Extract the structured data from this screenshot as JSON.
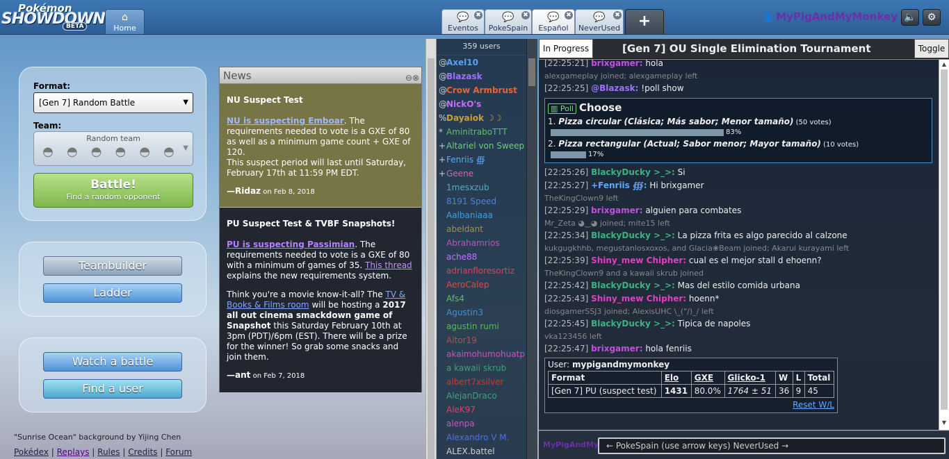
{
  "header": {
    "logo": {
      "line1": "Pokémon",
      "line2": "SHOWDOWN!",
      "line3": "BETA"
    },
    "home_tab": {
      "label": "Home",
      "icon": "home-icon"
    },
    "room_tabs": [
      {
        "label": "Eventos"
      },
      {
        "label": "PokeSpain"
      },
      {
        "label": "Español"
      },
      {
        "label": "NeverUsed"
      }
    ],
    "plus_label": "+",
    "close_glyph": "✖",
    "username": "MyPigAndMyMonkey",
    "sound_icon": "speaker-icon",
    "settings_icon": "gear-icon"
  },
  "mainmenu": {
    "format_label": "Format:",
    "format_value": "[Gen 7] Random Battle",
    "team_label": "Team:",
    "team_value": "Random team",
    "battle_title": "Battle!",
    "battle_sub": "Find a random opponent",
    "teambuilder": "Teambuilder",
    "ladder": "Ladder",
    "watch": "Watch a battle",
    "find_user": "Find a user"
  },
  "footer": {
    "credit": "\"Sunrise Ocean\" background by Yijing Chen",
    "links": [
      "Pokédex",
      "Replays",
      "Rules",
      "Credits",
      "Forum"
    ],
    "sep": " | "
  },
  "news": {
    "title": "News",
    "items": [
      {
        "heading": "NU Suspect Test",
        "link": "NU is suspecting Emboar",
        "body1": ". The requirements needed to vote is a GXE of 80 as well as a minimum game count + GXE of 120.",
        "body2": "This suspect period will last until Saturday, February 17th at 11:59 PM EDT.",
        "author": "—Ridaz",
        "date": " on Feb 8, 2018"
      },
      {
        "heading": "PU Suspect Test & TVBF Snapshots!",
        "link": "PU is suspecting Passimian",
        "body1": ". The requirements needed to vote is a GXE of 80 with a minimum of games of 35.",
        "link2": "This thread",
        "body2": "explains the new requirements system.",
        "body3a": "Think you're a movie know-it-all? The",
        "link3": "TV & Books & Films room",
        "body3b": "will be hosting a",
        "bold3": "2017 all out cinema smackdown game of Snapshot",
        "body3c": "this Saturday February 10th at 3pm (PDT)/6pm (EST). There will be a prize for the winner! So grab some snacks and join them.",
        "author": "—ant",
        "date": " on Feb 7, 2018"
      }
    ]
  },
  "userlist": {
    "count": "359 users",
    "users": [
      {
        "g": "@",
        "n": "Axel10",
        "c": "#5da0f0",
        "b": true
      },
      {
        "g": "@",
        "n": "Blazask",
        "c": "#a070ff",
        "b": true
      },
      {
        "g": "@",
        "n": "Crow Armbrust",
        "c": "#f06030",
        "b": true
      },
      {
        "g": "@",
        "n": "NickO's",
        "c": "#c070f0",
        "b": true
      },
      {
        "g": "%",
        "n": "Dayaiok ☽☽",
        "c": "#c8a030",
        "b": true
      },
      {
        "g": "*",
        "n": "AminitraboTTT",
        "c": "#60c060",
        "b": false
      },
      {
        "g": "+",
        "n": "Altariel von Sweep",
        "c": "#70d070",
        "b": false
      },
      {
        "g": "+",
        "n": "Fenriis ∰",
        "c": "#60a8ff",
        "b": false
      },
      {
        "g": "+",
        "n": "Geene",
        "c": "#e060a0",
        "b": false
      },
      {
        "g": "",
        "n": "1mesxzub",
        "c": "#50b0c0",
        "b": false
      },
      {
        "g": "",
        "n": "8191 Speed",
        "c": "#5080e0",
        "b": false
      },
      {
        "g": "",
        "n": "Aalbaniaaa",
        "c": "#40a0e0",
        "b": false
      },
      {
        "g": "",
        "n": "abeldant",
        "c": "#a09050",
        "b": false
      },
      {
        "g": "",
        "n": "Abrahamrios",
        "c": "#c050c0",
        "b": false
      },
      {
        "g": "",
        "n": "ache88",
        "c": "#c070ff",
        "b": false
      },
      {
        "g": "",
        "n": "adrianfloresortiz",
        "c": "#e04060",
        "b": false
      },
      {
        "g": "",
        "n": "AeroCalep",
        "c": "#f04040",
        "b": false
      },
      {
        "g": "",
        "n": "Afs4",
        "c": "#60c040",
        "b": false
      },
      {
        "g": "",
        "n": "Agustin3",
        "c": "#4090d0",
        "b": false
      },
      {
        "g": "",
        "n": "agustin rumi",
        "c": "#50c050",
        "b": false
      },
      {
        "g": "",
        "n": "Aitor19",
        "c": "#b05050",
        "b": false
      },
      {
        "g": "",
        "n": "akaimohumohuatp",
        "c": "#d050c0",
        "b": false
      },
      {
        "g": "",
        "n": "a kawaii skrub",
        "c": "#40a070",
        "b": false
      },
      {
        "g": "",
        "n": "albert7xsilver",
        "c": "#e03030",
        "b": false
      },
      {
        "g": "",
        "n": "AlejanDraco",
        "c": "#40a080",
        "b": false
      },
      {
        "g": "",
        "n": "AleK97",
        "c": "#e04070",
        "b": false
      },
      {
        "g": "",
        "n": "alenpa",
        "c": "#d050c0",
        "b": false
      },
      {
        "g": "",
        "n": "Alexandro V M.",
        "c": "#5070e0",
        "b": false
      },
      {
        "g": "",
        "n": "ALEX.battel",
        "c": "#d0d0d0",
        "b": false
      }
    ]
  },
  "room": {
    "in_progress": "In Progress",
    "title": "[Gen 7] OU Single Elimination Tournament",
    "toggle": "Toggle",
    "log_top": [
      {
        "type": "chat",
        "ts": "[22:25:21]",
        "name": "brixgamer:",
        "color": "#c050e0",
        "text": "hola"
      },
      {
        "type": "join",
        "text": "alexgameplay joined; alexgameplay left"
      },
      {
        "type": "chat",
        "ts": "[22:25:25]",
        "name": "@Blazask:",
        "color": "#a070ff",
        "text": "!poll show"
      }
    ],
    "poll": {
      "tag": "Poll",
      "question": "Choose",
      "options": [
        {
          "num": "1.",
          "label": "Pizza circular (Clásica; Más sabor; Menor tamaño)",
          "votes": "(50 votes)",
          "pct": "83%",
          "frac": 0.83
        },
        {
          "num": "2.",
          "label": "Pizza rectangular (Actual; Sabor menor; Mayor tamaño)",
          "votes": "(10 votes)",
          "pct": "17%",
          "frac": 0.17
        }
      ]
    },
    "log": [
      {
        "type": "chat",
        "ts": "[22:25:26]",
        "name": "BlackyDucky >_>:",
        "color": "#40b080",
        "text": "Si"
      },
      {
        "type": "chat",
        "ts": "[22:25:27]",
        "name": "+Fenriis ∰:",
        "color": "#60a8ff",
        "text": "Hi brixgamer"
      },
      {
        "type": "join",
        "text": "TheKingClown9 left"
      },
      {
        "type": "chat",
        "ts": "[22:25:29]",
        "name": "brixgamer:",
        "color": "#c050e0",
        "text": "alguien para combates"
      },
      {
        "type": "join",
        "text": "Mr_Zeta ◕‿◕ joined; mite15 left"
      },
      {
        "type": "chat",
        "ts": "[22:25:34]",
        "name": "BlackyDucky >_>:",
        "color": "#40b080",
        "text": "La pizza frita es algo parecido al calzone"
      },
      {
        "type": "join",
        "text": "kukgugkhhb, megustanlosxoxos, and Glacia❀Beam joined; Akarui kurayami left"
      },
      {
        "type": "chat",
        "ts": "[22:25:39]",
        "name": "Shiny_mew Chipher:",
        "color": "#e040c0",
        "text": "cual es el mejor stall d ehoenn?"
      },
      {
        "type": "join",
        "text": "TheKingClown9 and a kawaii skrub joined"
      },
      {
        "type": "chat",
        "ts": "[22:25:42]",
        "name": "BlackyDucky >_>:",
        "color": "#40b080",
        "text": "Mas del estilo comida urbana"
      },
      {
        "type": "chat",
        "ts": "[22:25:43]",
        "name": "Shiny_mew Chipher:",
        "color": "#e040c0",
        "text": "hoenn*"
      },
      {
        "type": "join",
        "text": "diosgamerSSJ3 joined; AlexisUHC \\_(\"/)_/ left"
      },
      {
        "type": "chat",
        "ts": "[22:25:45]",
        "name": "BlackyDucky >_>:",
        "color": "#40b080",
        "text": "Tipica de napoles"
      },
      {
        "type": "join",
        "text": "vka123456 left"
      },
      {
        "type": "chat",
        "ts": "[22:25:47]",
        "name": "brixgamer:",
        "color": "#c050e0",
        "text": "hola fenriis"
      }
    ],
    "stats": {
      "user_label": "User:",
      "user": "mypigandmymonkey",
      "headers": [
        "Format",
        "Elo",
        "GXE",
        "Glicko-1",
        "W",
        "L",
        "Total"
      ],
      "row": {
        "format": "[Gen 7] PU (suspect test)",
        "elo": "1431",
        "gxe": "80.0%",
        "glicko": "1764 ± 51",
        "w": "36",
        "l": "9",
        "total": "45"
      },
      "reset": "Reset W/L"
    },
    "chatbar_user": "MyPigAndMy",
    "chatbar_placeholder": "← PokeSpain (use arrow keys) NeverUsed →"
  }
}
